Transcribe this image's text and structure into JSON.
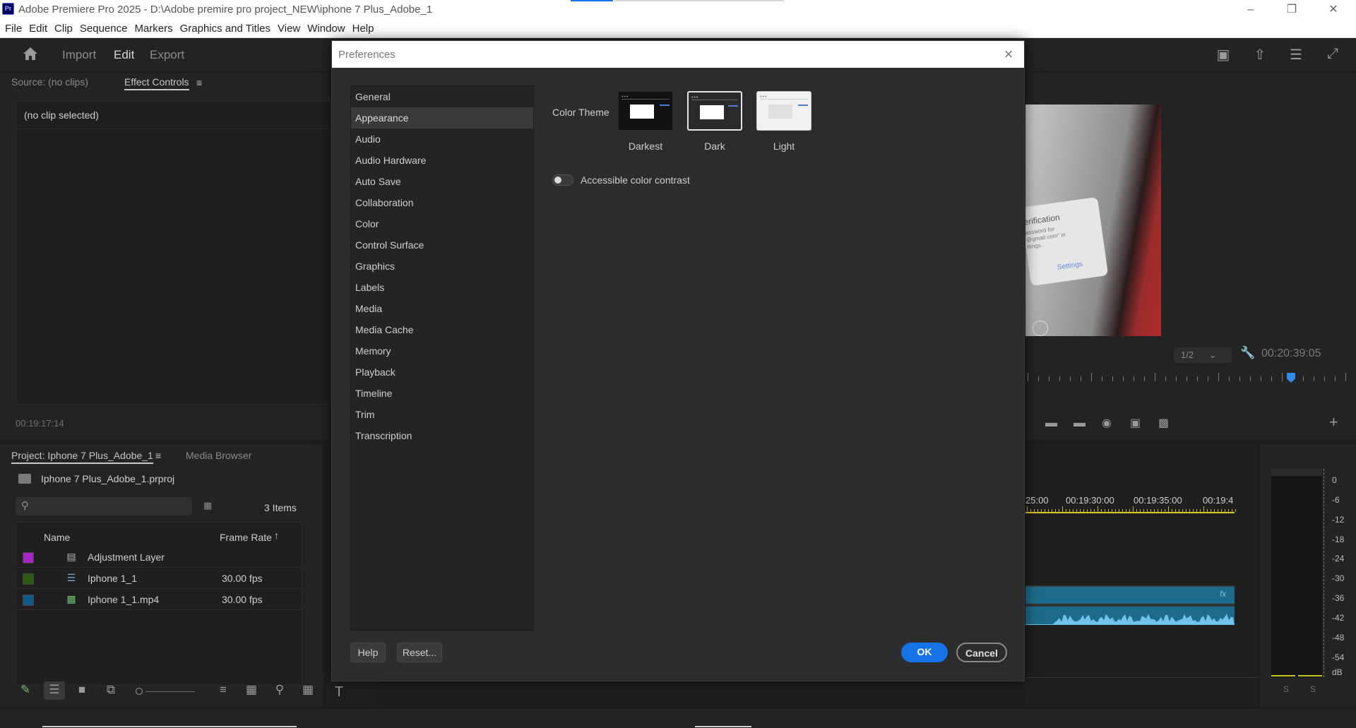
{
  "window": {
    "title": "Adobe Premiere Pro 2025 - D:\\Adobe premire pro project_NEW\\iphone 7 Plus_Adobe_1",
    "app_badge": "Pr",
    "accent": "#1473e6"
  },
  "menu": [
    "File",
    "Edit",
    "Clip",
    "Sequence",
    "Markers",
    "Graphics and Titles",
    "View",
    "Window",
    "Help"
  ],
  "workspace": {
    "tabs": [
      {
        "label": "Import",
        "active": false
      },
      {
        "label": "Edit",
        "active": true
      },
      {
        "label": "Export",
        "active": false
      }
    ]
  },
  "source_panel": {
    "tabs": [
      {
        "label": "Source: (no clips)",
        "active": false
      },
      {
        "label": "Effect Controls",
        "active": true
      }
    ],
    "empty_text": "(no clip selected)",
    "timecode": "00:19:17:14"
  },
  "project_panel": {
    "tabs": [
      {
        "label": "Project: Iphone 7 Plus_Adobe_1",
        "active": true
      },
      {
        "label": "Media Browser",
        "active": false
      }
    ],
    "project_file": "Iphone 7 Plus_Adobe_1.prproj",
    "item_count": "3 Items",
    "columns": {
      "name": "Name",
      "frame_rate": "Frame Rate"
    },
    "items": [
      {
        "name": "Adjustment Layer",
        "frame_rate": "",
        "color": "#a626c8",
        "icon": "adjustment-layer-icon"
      },
      {
        "name": "Iphone 1_1",
        "frame_rate": "30.00 fps",
        "color": "#2d5b14",
        "icon": "sequence-icon"
      },
      {
        "name": "Iphone 1_1.mp4",
        "frame_rate": "30.00 fps",
        "color": "#0f5a8a",
        "icon": "video-clip-icon"
      }
    ]
  },
  "preferences": {
    "title": "Preferences",
    "categories": [
      "General",
      "Appearance",
      "Audio",
      "Audio Hardware",
      "Auto Save",
      "Collaboration",
      "Color",
      "Control Surface",
      "Graphics",
      "Labels",
      "Media",
      "Media Cache",
      "Memory",
      "Playback",
      "Timeline",
      "Trim",
      "Transcription"
    ],
    "selected_category": "Appearance",
    "color_theme_label": "Color Theme",
    "themes": [
      {
        "label": "Darkest",
        "selected": false
      },
      {
        "label": "Dark",
        "selected": true
      },
      {
        "label": "Light",
        "selected": false
      }
    ],
    "accessible_contrast_label": "Accessible color contrast",
    "accessible_contrast_on": false,
    "buttons": {
      "help": "Help",
      "reset": "Reset...",
      "ok": "OK",
      "cancel": "Cancel"
    }
  },
  "program_monitor": {
    "resolution": "1/2",
    "timecode": "00:20:39:05",
    "preview_text": [
      "erification",
      "assword for",
      "@gmail.com\" in",
      "ttings.",
      "Settings"
    ]
  },
  "timeline": {
    "timecodes": [
      "25:00",
      "00:19:30:00",
      "00:19:35:00",
      "00:19:4"
    ]
  },
  "audio_meter": {
    "labels": [
      "0",
      "-6",
      "-12",
      "-18",
      "-24",
      "-30",
      "-36",
      "-42",
      "-48",
      "-54",
      "dB"
    ],
    "solo": [
      "S",
      "S"
    ]
  }
}
